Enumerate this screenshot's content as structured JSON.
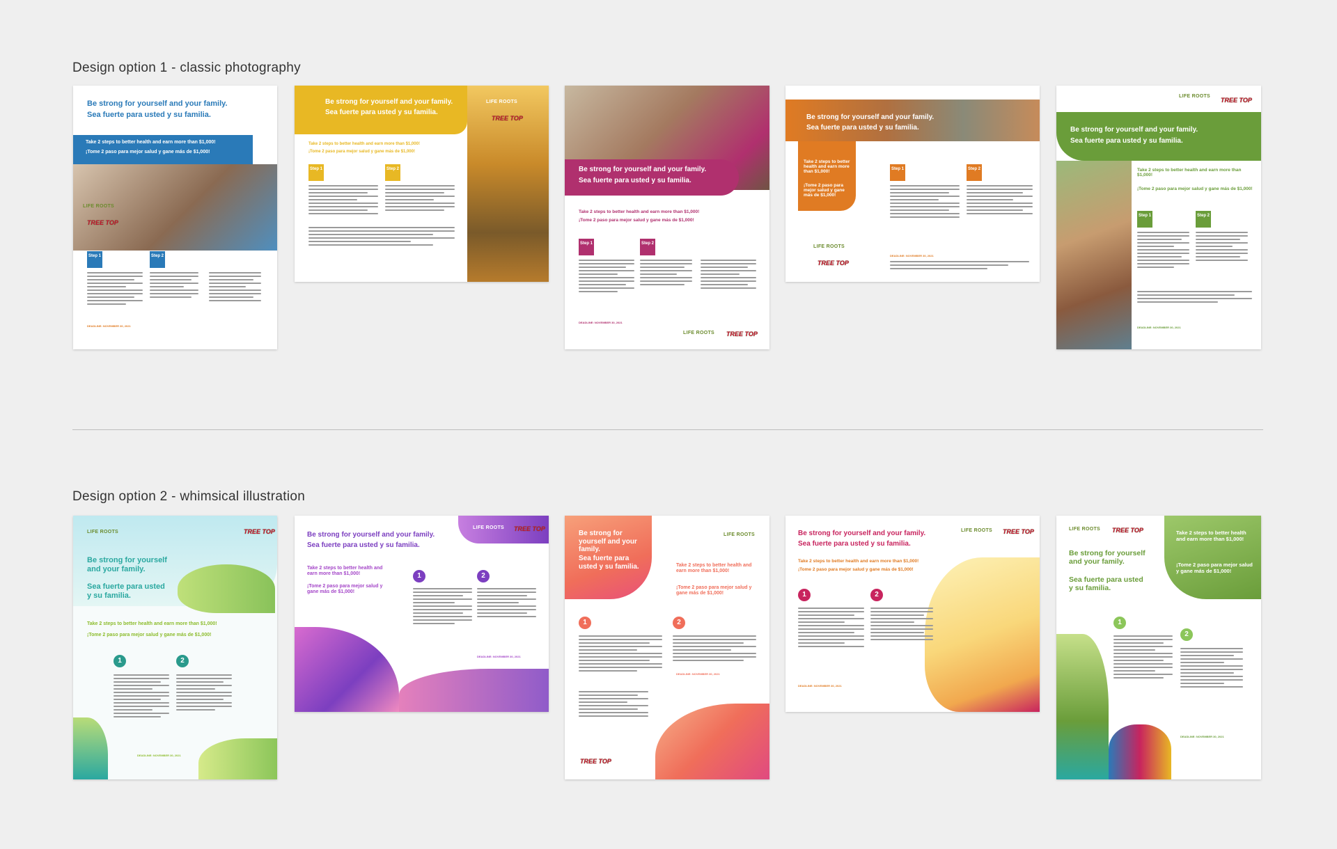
{
  "sections": {
    "option1_title": "Design option 1 - classic photography",
    "option2_title": "Design option 2 - whimsical illustration"
  },
  "flyer": {
    "headline_en": "Be strong for yourself and your family.",
    "headline_es": "Sea fuerte para usted  y su familia.",
    "tagline_en": "Take 2 steps to better health and earn more than $1,000!",
    "tagline_es": "¡Tome 2 paso para  mejor salud y gane más de $1,000!",
    "step1_label": "Step 1",
    "step2_label": "Step 2",
    "num1": "1",
    "num2": "2",
    "deadline": "DEADLINE: NOVEMBER 30, 2021",
    "logo_life": "LIFE ROOTS",
    "logo_tree": "TREE TOP"
  },
  "colors": {
    "blue": "#2a7ab8",
    "yellow": "#e8b824",
    "magenta": "#b0306e",
    "orange": "#e07b23",
    "green": "#6a9d3a",
    "teal": "#2aa8a0",
    "purple": "#7c3fc0",
    "coral": "#f06e5a"
  }
}
